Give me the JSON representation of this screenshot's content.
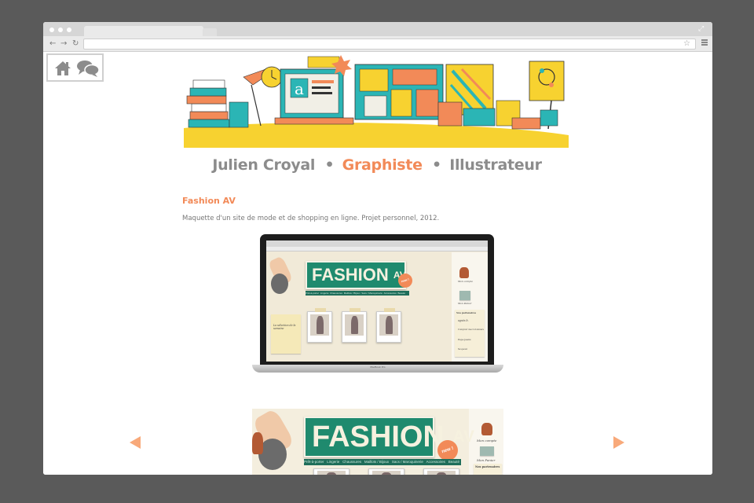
{
  "browser": {
    "url": "",
    "buttons": {
      "back": "←",
      "forward": "→",
      "reload": "↻",
      "bookmark": "☆",
      "expand": "⤢"
    }
  },
  "site": {
    "icons": {
      "home": "home-icon",
      "chat": "chat-icon"
    },
    "title": {
      "name": "Julien Croyal",
      "sep1": "•",
      "role1": "Graphiste",
      "sep2": "•",
      "role2": "Illustrateur"
    },
    "project": {
      "title": "Fashion AV",
      "description": "Maquette d'un site de mode et de shopping en ligne. Projet personnel, 2012."
    },
    "laptop_label": "MacBook Pro",
    "mockup": {
      "sign_text": "FASHION",
      "sign_sup": "AV",
      "badge": "new !",
      "nav": [
        "Prêt-à-porter",
        "Lingerie",
        "Chaussures",
        "Maillots / Bijoux",
        "Sacs / Maroquinerie",
        "Accessoires",
        "Beauté"
      ],
      "selection": "La sélection de la semaine",
      "sidebar": [
        "Mon compte",
        "Mon Panier"
      ],
      "partners_title": "Nos partenaires",
      "partners": [
        "agnès b.",
        "Comptoir des Cotonniers",
        "Pepe Jeans",
        "Sequoia"
      ]
    },
    "colors": {
      "accent": "#f28a58",
      "title_gray": "#8c8c8c",
      "teal": "#1f8a6e",
      "arrow": "#f8a97a"
    }
  }
}
